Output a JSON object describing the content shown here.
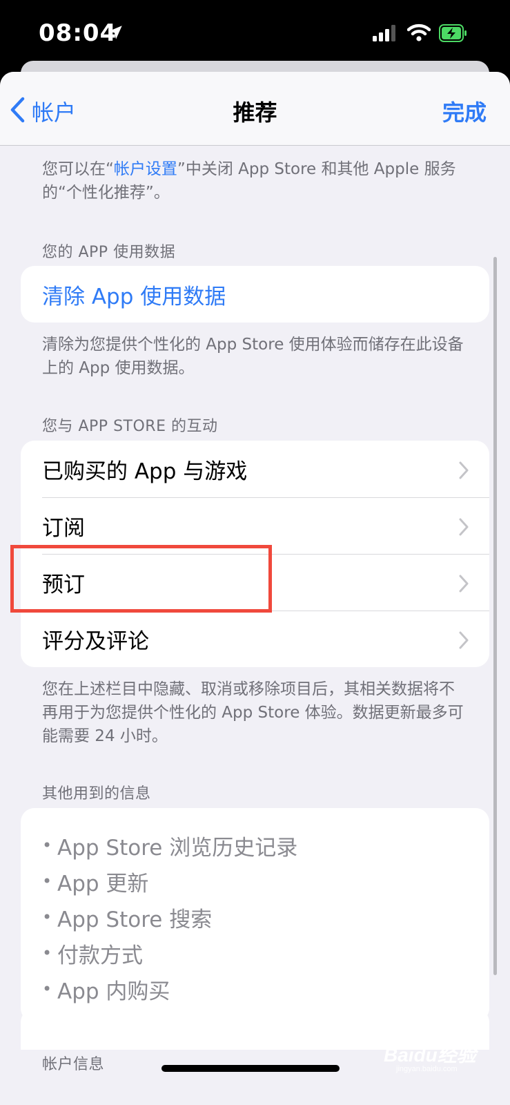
{
  "status_bar": {
    "time": "08:04"
  },
  "nav": {
    "back_label": "帐户",
    "title": "推荐",
    "done_label": "完成"
  },
  "intro": {
    "prefix": "您可以在“",
    "link": "帐户设置",
    "suffix": "”中关闭 App Store 和其他 Apple 服务的“个性化推荐”。"
  },
  "usage_section": {
    "header": "您的 APP 使用数据",
    "action_label": "清除 App 使用数据",
    "footer": "清除为您提供个性化的 App Store 使用体验而储存在此设备上的 App 使用数据。"
  },
  "interaction_section": {
    "header": "您与 APP STORE 的互动",
    "rows": [
      "已购买的 App 与游戏",
      "订阅",
      "预订",
      "评分及评论"
    ],
    "footer": "您在上述栏目中隐藏、取消或移除项目后，其相关数据将不再用于为您提供个性化的 App Store 体验。数据更新最多可能需要 24 小时。"
  },
  "other_info_section": {
    "header": "其他用到的信息",
    "items": [
      "App Store 浏览历史记录",
      "App 更新",
      "App Store 搜索",
      "付款方式",
      "App 内购买"
    ]
  },
  "account_section": {
    "header": "帐户信息"
  },
  "watermark": {
    "logo": "Baidu经验",
    "url": "jingyan.baidu.com"
  },
  "colors": {
    "accent": "#2f7bf6",
    "highlight": "#f0493c",
    "background": "#f1f0f6"
  },
  "icons": [
    "location-arrow-icon",
    "cellular-signal-icon",
    "wifi-icon",
    "battery-charging-icon",
    "chevron-left-icon",
    "chevron-right-icon"
  ]
}
